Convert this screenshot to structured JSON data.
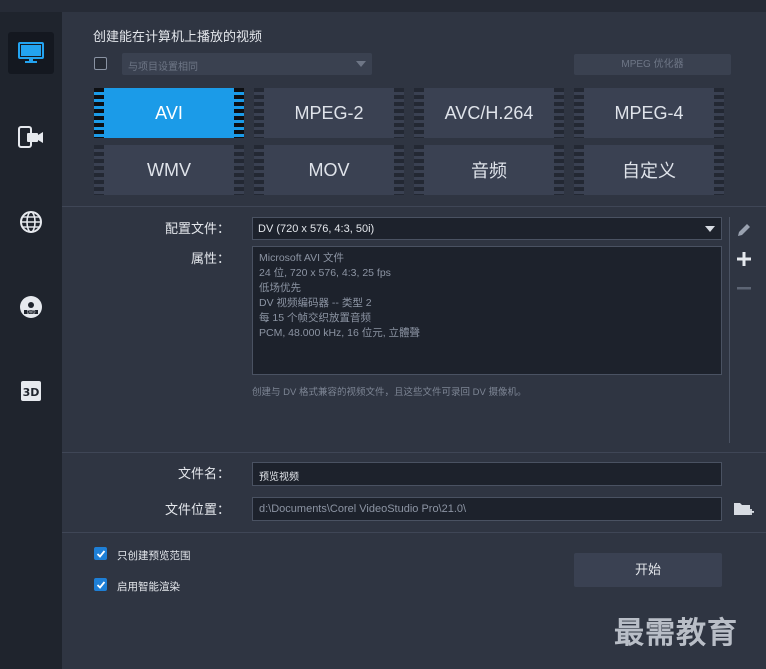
{
  "sidebar": {
    "items": [
      {
        "name": "computer",
        "icon": "monitor-icon",
        "active": true
      },
      {
        "name": "device",
        "icon": "mobile-camera-icon",
        "active": false
      },
      {
        "name": "web",
        "icon": "globe-icon",
        "active": false
      },
      {
        "name": "disc",
        "icon": "dvd-disc-icon",
        "active": false
      },
      {
        "name": "3d",
        "icon": "3d-icon",
        "active": false
      }
    ]
  },
  "header": {
    "title": "创建能在计算机上播放的视频",
    "project_dropdown": "与项目设置相同",
    "mpeg_optimizer": "MPEG 优化器"
  },
  "formats": [
    {
      "label": "AVI",
      "active": true
    },
    {
      "label": "MPEG-2",
      "active": false
    },
    {
      "label": "AVC/H.264",
      "active": false
    },
    {
      "label": "MPEG-4",
      "active": false
    },
    {
      "label": "WMV",
      "active": false
    },
    {
      "label": "MOV",
      "active": false
    },
    {
      "label": "音频",
      "active": false
    },
    {
      "label": "自定义",
      "active": false
    }
  ],
  "settings": {
    "profile_label": "配置文件：",
    "profile_value": "DV (720 x 576, 4:3, 50i)",
    "properties_label": "属性：",
    "properties_lines": [
      "Microsoft AVI 文件",
      "24 位, 720 x 576, 4:3, 25 fps",
      "低场优先",
      "DV 视频编码器 -- 类型 2",
      "每 15 个帧交织放置音频",
      "PCM, 48.000 kHz, 16 位元, 立體聲"
    ],
    "description": "创建与 DV 格式兼容的视频文件，且这些文件可录回 DV 摄像机。"
  },
  "file": {
    "name_label": "文件名：",
    "name_value": "预览视频",
    "location_label": "文件位置：",
    "location_value": "d:\\Documents\\Corel VideoStudio Pro\\21.0\\"
  },
  "options": {
    "preview_only": "只创建预览范围",
    "smart_render": "启用智能渲染",
    "preview_only_checked": true,
    "smart_render_checked": true
  },
  "actions": {
    "start": "开始"
  },
  "watermark": "最需教育",
  "colors": {
    "accent": "#1b9be8",
    "checkbox": "#1e7fd6"
  }
}
